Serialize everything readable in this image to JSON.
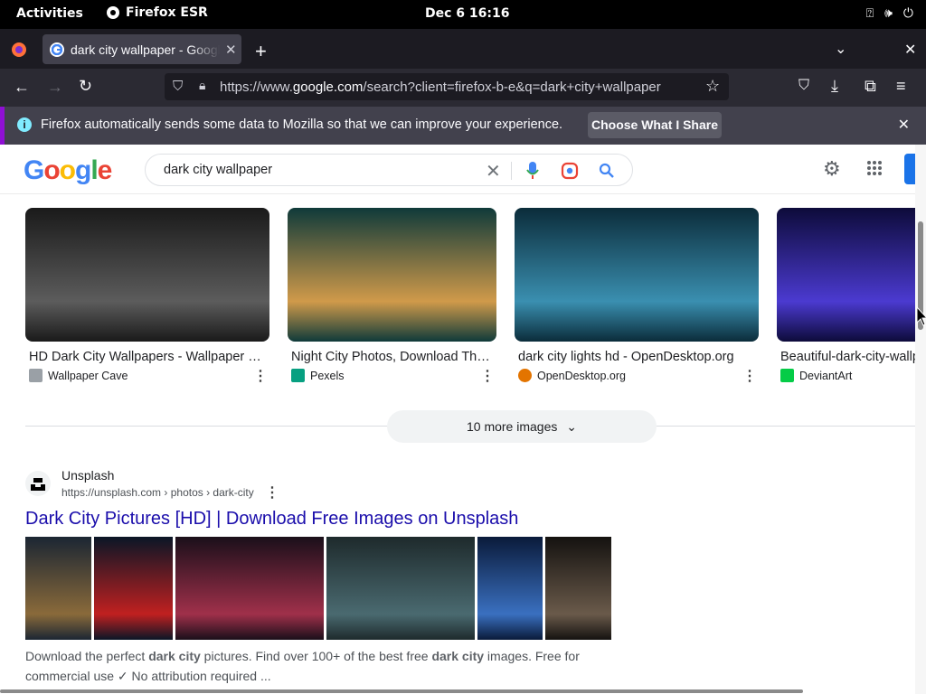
{
  "system_bar": {
    "activities": "Activities",
    "app_name": "Firefox ESR",
    "clock": "Dec 6  16:16"
  },
  "browser": {
    "tab_title": "dark city wallpaper - Google Search",
    "url_prefix": "https://www.",
    "url_domain": "google.com",
    "url_rest": "/search?client=firefox-b-e&q=dark+city+wallpaper",
    "notification_text": "Firefox automatically sends some data to Mozilla so that we can improve your experience.",
    "notification_button": "Choose What I Share"
  },
  "google": {
    "logo_text": "Google",
    "query": "dark city wallpaper"
  },
  "images": [
    {
      "caption": "HD Dark City Wallpapers - Wallpaper Cave",
      "source": "Wallpaper Cave",
      "colors": [
        "#1a1a1a",
        "#5c5c5c"
      ],
      "source_color": "#9aa0a6"
    },
    {
      "caption": "Night City Photos, Download The BEST Free",
      "source": "Pexels",
      "colors": [
        "#0f3a3a",
        "#d09a4a"
      ],
      "source_color": "#07a081"
    },
    {
      "caption": "dark city lights hd - OpenDesktop.org",
      "source": "OpenDesktop.org",
      "colors": [
        "#0b2c3a",
        "#3a8fb0"
      ],
      "source_color": "#e37400"
    },
    {
      "caption": "Beautiful-dark-city-wallpaper",
      "source": "DeviantArt",
      "colors": [
        "#0d0b3a",
        "#4b3ad0"
      ],
      "source_color": "#05cc47"
    }
  ],
  "more_images": "10 more images",
  "result": {
    "site_name": "Unsplash",
    "site_url": "https://unsplash.com › photos › dark-city",
    "title": "Dark City Pictures [HD] | Download Free Images on Unsplash",
    "snippet_1": "Download the perfect ",
    "snippet_b1": "dark city",
    "snippet_2": " pictures. Find over 100+ of the best free ",
    "snippet_b2": "dark city",
    "snippet_3": " images. Free for commercial use ✓ No attribution required ...",
    "thumbnails": [
      {
        "colors": [
          "#1b2633",
          "#8a6a3a"
        ]
      },
      {
        "colors": [
          "#0a1626",
          "#c02020"
        ]
      },
      {
        "colors": [
          "#1a0f1a",
          "#a0304a"
        ]
      },
      {
        "colors": [
          "#1e2a2c",
          "#4a6a70"
        ]
      },
      {
        "colors": [
          "#0a1a3a",
          "#3a70c0"
        ]
      },
      {
        "colors": [
          "#141210",
          "#6a5a4a"
        ]
      }
    ]
  }
}
